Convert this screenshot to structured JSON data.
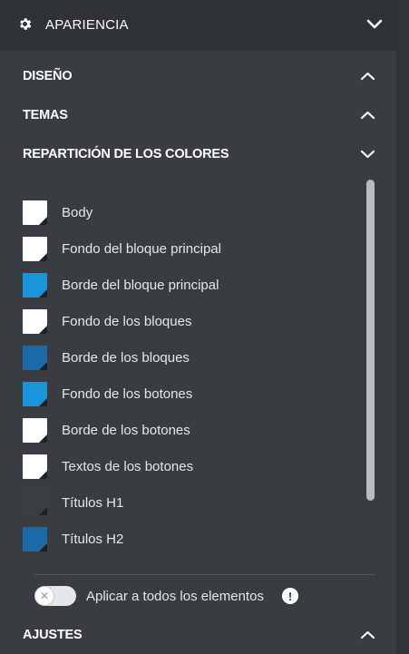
{
  "header": {
    "title": "APARIENCIA",
    "icon": "gear-icon"
  },
  "sections": [
    {
      "label": "DISEÑO",
      "state": "collapsed"
    },
    {
      "label": "TEMAS",
      "state": "collapsed"
    },
    {
      "label": "REPARTICIÓN DE LOS COLORES",
      "state": "expanded"
    }
  ],
  "colors": [
    {
      "label": "Body",
      "color": "#ffffff"
    },
    {
      "label": "Fondo del bloque principal",
      "color": "#ffffff"
    },
    {
      "label": "Borde del bloque principal",
      "color": "#1a95dc"
    },
    {
      "label": "Fondo de los bloques",
      "color": "#ffffff"
    },
    {
      "label": "Borde de los bloques",
      "color": "#1c6aa8"
    },
    {
      "label": "Fondo de los botones",
      "color": "#1a95dc"
    },
    {
      "label": "Borde de los botones",
      "color": "#ffffff"
    },
    {
      "label": "Textos de los botones",
      "color": "#ffffff"
    },
    {
      "label": "Títulos H1",
      "color": "#3a3d41"
    },
    {
      "label": "Títulos H2",
      "color": "#1c6aa8"
    }
  ],
  "apply_all": {
    "label": "Aplicar a todos los elementos",
    "enabled": false
  },
  "footer_section": {
    "label": "AJUSTES",
    "state": "collapsed"
  }
}
